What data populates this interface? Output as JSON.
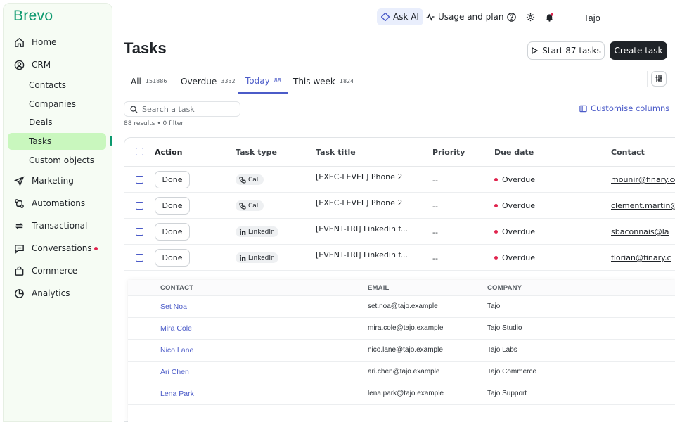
{
  "brand": "Brevo",
  "sidebar": {
    "items": [
      {
        "label": "Home",
        "icon": "home-icon"
      },
      {
        "label": "CRM",
        "icon": "user-circle-icon"
      },
      {
        "label": "Marketing",
        "icon": "send-icon"
      },
      {
        "label": "Automations",
        "icon": "automation-icon"
      },
      {
        "label": "Transactional",
        "icon": "repeat-icon"
      },
      {
        "label": "Conversations",
        "icon": "chat-icon"
      },
      {
        "label": "Commerce",
        "icon": "bag-icon"
      },
      {
        "label": "Analytics",
        "icon": "pie-chart-icon"
      }
    ],
    "crm_subitems": [
      "Contacts",
      "Companies",
      "Deals",
      "Tasks",
      "Custom objects"
    ],
    "active_subitem": "Tasks"
  },
  "topbar": {
    "ask_ai": "Ask AI",
    "usage": "Usage and plan",
    "account": "Tajo"
  },
  "header": {
    "title": "Tasks",
    "start_button": "Start 87 tasks",
    "create_button": "Create task"
  },
  "tabs": [
    {
      "label": "All",
      "count": "151886"
    },
    {
      "label": "Overdue",
      "count": "3332"
    },
    {
      "label": "Today",
      "count": "88"
    },
    {
      "label": "This week",
      "count": "1824"
    }
  ],
  "active_tab": "Today",
  "search": {
    "placeholder": "Search a task"
  },
  "results": "88 results  •  0 filter",
  "customise": "Customise columns",
  "table": {
    "columns": [
      "Action",
      "Task type",
      "Task title",
      "Priority",
      "Due date",
      "Contact"
    ],
    "rows": [
      {
        "action": "Done",
        "type": "Call",
        "title": "[EXEC-LEVEL] Phone 2",
        "priority": "--",
        "due": "Overdue",
        "contact": "mounir@finary.com"
      },
      {
        "action": "Done",
        "type": "Call",
        "title": "[EXEC-LEVEL] Phone 2",
        "priority": "--",
        "due": "Overdue",
        "contact": "clement.martin@"
      },
      {
        "action": "Done",
        "type": "LinkedIn",
        "title": "[EVENT-TRI] Linkedin f...",
        "priority": "--",
        "due": "Overdue",
        "contact": "sbaconnais@la"
      },
      {
        "action": "Done",
        "type": "LinkedIn",
        "title": "[EVENT-TRI] Linkedin f...",
        "priority": "--",
        "due": "Overdue",
        "contact": "florian@finary.c"
      }
    ]
  },
  "popover": {
    "columns": [
      "CONTACT",
      "EMAIL",
      "COMPANY"
    ],
    "rows": [
      {
        "name": "Set Noa",
        "email": "set.noa@tajo.example",
        "company": "Tajo"
      },
      {
        "name": "Mira Cole",
        "email": "mira.cole@tajo.example",
        "company": "Tajo Studio"
      },
      {
        "name": "Nico Lane",
        "email": "nico.lane@tajo.example",
        "company": "Tajo Labs"
      },
      {
        "name": "Ari Chen",
        "email": "ari.chen@tajo.example",
        "company": "Tajo Commerce"
      },
      {
        "name": "Lena Park",
        "email": "lena.park@tajo.example",
        "company": "Tajo Support"
      }
    ]
  },
  "colors": {
    "brand_green": "#0b996e",
    "active_nav_bg": "#c9f7be",
    "accent_blue": "#4b5bc8",
    "overdue_red": "#e0234d"
  }
}
